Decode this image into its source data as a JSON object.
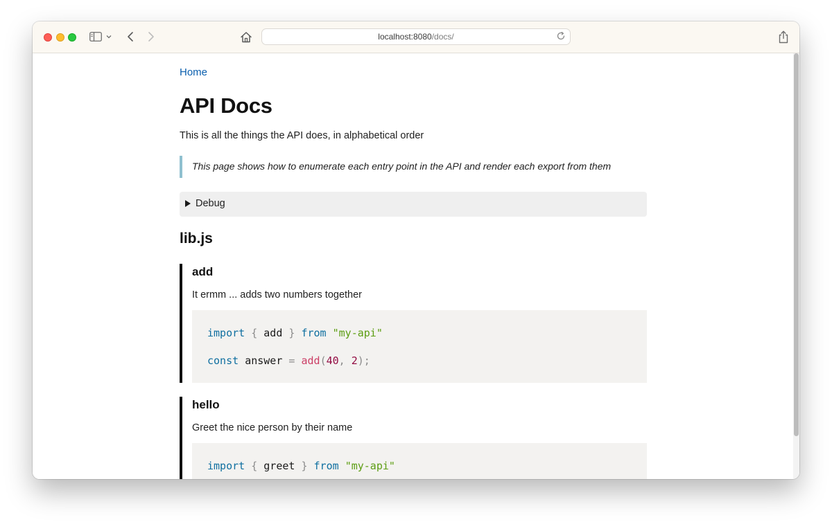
{
  "browser": {
    "url_host": "localhost:8080",
    "url_path": "/docs/"
  },
  "page": {
    "home_link": "Home",
    "title": "API Docs",
    "intro": "This is all the things the API does, in alphabetical order",
    "note": "This page shows how to enumerate each entry point in the API and render each export from them",
    "debug_label": "Debug",
    "file_title": "lib.js"
  },
  "entries": [
    {
      "name": "add",
      "description": "It ermm ... adds two numbers together",
      "code": {
        "line1": {
          "kw": "import",
          "open": "{",
          "ident": "add",
          "close": "}",
          "from": "from",
          "str": "\"my-api\""
        },
        "line2": {
          "kw": "const",
          "ident": "answer",
          "eq": "=",
          "fn": "add",
          "open": "(",
          "n1": "40",
          "comma": ",",
          "n2": "2",
          "close": ");"
        }
      }
    },
    {
      "name": "hello",
      "description": "Greet the nice person by their name",
      "code": {
        "line1": {
          "kw": "import",
          "open": "{",
          "ident": "greet",
          "close": "}",
          "from": "from",
          "str": "\"my-api\""
        }
      }
    }
  ],
  "icons": {
    "sidebar": "sidebar-icon",
    "chevron_down": "chevron-down-icon",
    "back": "back-icon",
    "forward": "forward-icon",
    "home": "home-icon",
    "reload": "reload-icon",
    "share": "share-icon"
  },
  "colors": {
    "link": "#0b5fae",
    "note_border": "#8fc0cf",
    "keyword": "#0f6fa0",
    "string": "#5c9d12",
    "function": "#cc3f66",
    "number": "#930d43"
  }
}
